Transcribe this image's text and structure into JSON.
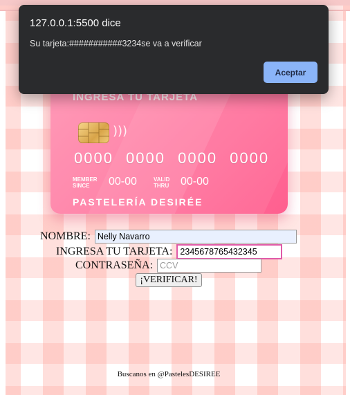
{
  "dialog": {
    "title": "127.0.0.1:5500 dice",
    "message": "Su tarjeta:###########3234se va a verificar",
    "accept_label": "Aceptar"
  },
  "card": {
    "title": "INGRESA TU TARJETA",
    "number": "0000 0000 0000 0000",
    "member_label_1": "MEMBER",
    "member_label_2": "SINCE",
    "member_value": "00-00",
    "valid_label_1": "VALID",
    "valid_label_2": "THRU",
    "valid_value": "00-00",
    "brand": "PASTELERÍA DESIRÉE",
    "contactless_icon": "contactless-icon",
    "chip_icon": "chip-icon"
  },
  "form": {
    "name_label": "NOMBRE:",
    "name_value": "Nelly Navarro",
    "card_label": "INGRESA TU TARJETA:",
    "card_value": "2345678765432345",
    "password_label": "CONTRASEÑA:",
    "password_placeholder": "CCV",
    "verify_label": "¡VERIFICAR!"
  },
  "footer": {
    "text": "Buscanos en @PastelesDESIREE"
  },
  "colors": {
    "dialog_bg": "#2a2b2d",
    "accept_button": "#8ab4f8",
    "card_pink": "#ff6f99",
    "card_input_border": "#e05aa8",
    "stripe": "#ffc9c3"
  }
}
